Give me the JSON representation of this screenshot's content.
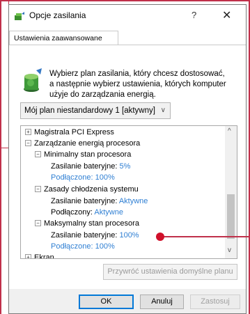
{
  "window": {
    "title": "Opcje zasilania",
    "help": "?",
    "close": "✕",
    "icon": "power-options-icon"
  },
  "tab": {
    "label": "Ustawienia zaawansowane"
  },
  "description": {
    "line1": "Wybierz plan zasilania, który chcesz dostosować,",
    "line2": "a następnie wybierz ustawienia, których komputer",
    "line3": "użyje do zarządzania energią."
  },
  "plan_select": {
    "value": "Mój plan niestandardowy 1 [aktywny]",
    "chevron": "∨"
  },
  "tree": {
    "items": [
      {
        "label": "Magistrala PCI Express",
        "toggle": "+"
      },
      {
        "label": "Zarządzanie energią procesora",
        "toggle": "−"
      },
      {
        "label": "Minimalny stan procesora",
        "toggle": "−"
      },
      {
        "label": "Zasilanie bateryjne:",
        "value": "5%"
      },
      {
        "label": "Podłączone:",
        "value": "100%"
      },
      {
        "label": "Zasady chłodzenia systemu",
        "toggle": "−"
      },
      {
        "label": "Zasilanie bateryjne:",
        "value": "Aktywne"
      },
      {
        "label": "Podłączony:",
        "value": "Aktywne"
      },
      {
        "label": "Maksymalny stan procesora",
        "toggle": "−"
      },
      {
        "label": "Zasilanie bateryjne:",
        "value": "100%"
      },
      {
        "label": "Podłączone:",
        "value": "100%"
      },
      {
        "label": "Ekran",
        "toggle": "+"
      }
    ],
    "scroll_up": "^",
    "scroll_down": "v"
  },
  "buttons": {
    "restore": "Przywróć ustawienia domyślne planu",
    "ok": "OK",
    "cancel": "Anuluj",
    "apply": "Zastosuj"
  },
  "colors": {
    "accent": "#0078d7",
    "value_link": "#2f7fd3",
    "annotation": "#d0102a"
  }
}
